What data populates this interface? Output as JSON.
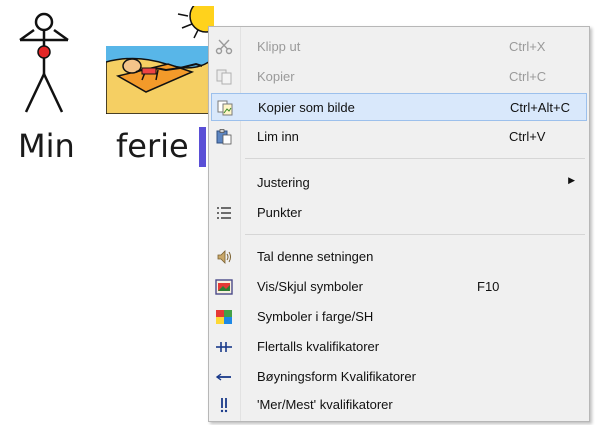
{
  "document": {
    "words": [
      "Min",
      "ferie"
    ]
  },
  "context_menu": {
    "items": [
      {
        "label": "Klipp ut",
        "shortcut": "Ctrl+X",
        "icon": "scissors-icon",
        "disabled": true
      },
      {
        "label": "Kopier",
        "shortcut": "Ctrl+C",
        "icon": "copy-icon",
        "disabled": true
      },
      {
        "label": "Kopier som bilde",
        "shortcut": "Ctrl+Alt+C",
        "icon": "copy-as-image-icon",
        "disabled": false,
        "highlighted": true
      },
      {
        "label": "Lim inn",
        "shortcut": "Ctrl+V",
        "icon": "paste-icon",
        "disabled": false
      },
      {
        "label": "Justering",
        "shortcut": "",
        "icon": "",
        "disabled": false,
        "submenu": true
      },
      {
        "label": "Punkter",
        "shortcut": "",
        "icon": "bullets-icon",
        "disabled": false
      },
      {
        "label": "Tal denne setningen",
        "shortcut": "",
        "icon": "speaker-icon",
        "disabled": false
      },
      {
        "label": "Vis/Skjul symboler",
        "shortcut": "F10",
        "icon": "show-hide-symbols-icon",
        "disabled": false
      },
      {
        "label": "Symboler i farge/SH",
        "shortcut": "",
        "icon": "color-symbols-icon",
        "disabled": false
      },
      {
        "label": "Flertalls kvalifikatorer",
        "shortcut": "",
        "icon": "plural-qualifier-icon",
        "disabled": false
      },
      {
        "label": "Bøyningsform Kvalifikatorer",
        "shortcut": "",
        "icon": "inflection-qualifier-icon",
        "disabled": false
      },
      {
        "label": "'Mer/Mest' kvalifikatorer",
        "shortcut": "",
        "icon": "comparative-qualifier-icon",
        "disabled": false
      }
    ]
  },
  "colors": {
    "menu_bg": "#f0f0f0",
    "highlight": "#d9e8fb",
    "caret": "#5a4fd6"
  }
}
